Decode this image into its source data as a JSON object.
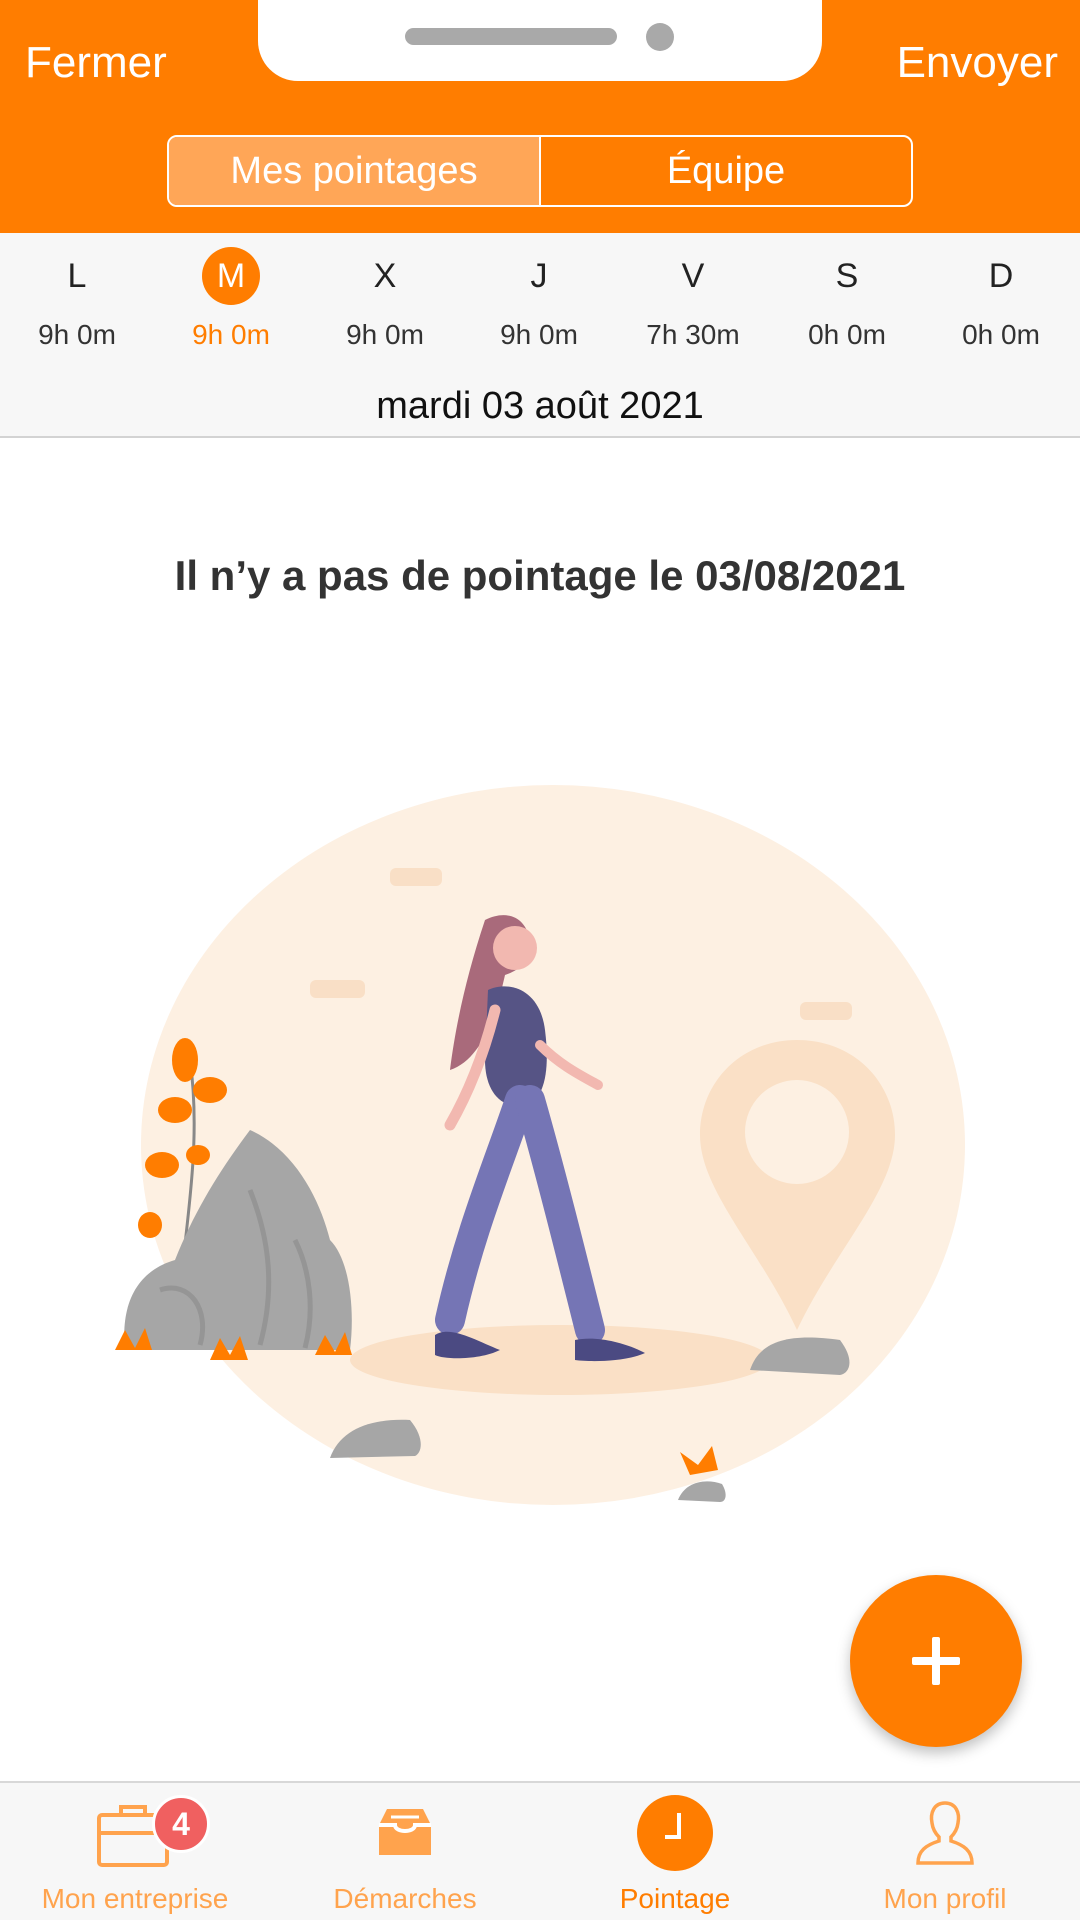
{
  "header": {
    "close_label": "Fermer",
    "send_label": "Envoyer",
    "tabs": [
      {
        "label": "Mes pointages",
        "active": true
      },
      {
        "label": "Équipe",
        "active": false
      }
    ]
  },
  "week": {
    "days": [
      {
        "letter": "L",
        "hours": "9h 0m",
        "active": false
      },
      {
        "letter": "M",
        "hours": "9h 0m",
        "active": true
      },
      {
        "letter": "X",
        "hours": "9h 0m",
        "active": false
      },
      {
        "letter": "J",
        "hours": "9h 0m",
        "active": false
      },
      {
        "letter": "V",
        "hours": "7h 30m",
        "active": false
      },
      {
        "letter": "S",
        "hours": "0h 0m",
        "active": false
      },
      {
        "letter": "D",
        "hours": "0h 0m",
        "active": false
      }
    ],
    "selected_date": "mardi 03 août 2021"
  },
  "main": {
    "empty_message": "Il n’y a pas de pointage le 03/08/2021"
  },
  "fab": {
    "icon": "plus-icon"
  },
  "tabbar": {
    "items": [
      {
        "label": "Mon entreprise",
        "icon": "briefcase-icon",
        "badge": "4",
        "active": false
      },
      {
        "label": "Démarches",
        "icon": "inbox-icon",
        "active": false
      },
      {
        "label": "Pointage",
        "icon": "clock-icon",
        "active": true
      },
      {
        "label": "Mon profil",
        "icon": "user-icon",
        "active": false
      }
    ]
  },
  "colors": {
    "accent": "#ff7d00",
    "segment_active": "#ffa657",
    "badge": "#f06060",
    "tab_inactive": "#ffa34d"
  }
}
